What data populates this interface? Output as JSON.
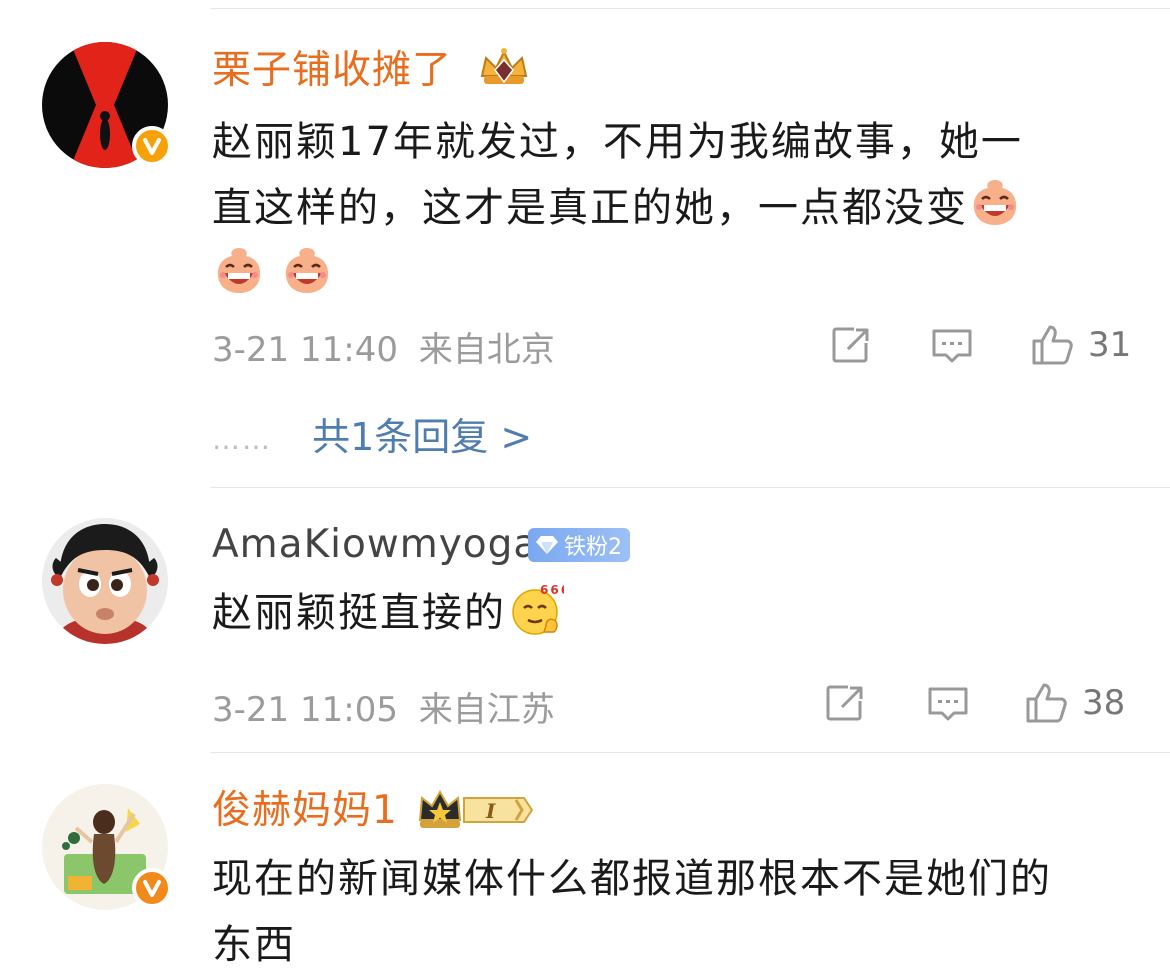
{
  "comments": [
    {
      "username": "栗子铺收摊了",
      "text_lines": [
        "赵丽颖17年就发过，不用为我编故事，她一",
        "直这样的，这才是真正的她，一点都没变"
      ],
      "time": "3-21 11:40",
      "location": "来自北京",
      "likes": "31",
      "reply_dots": "……",
      "reply_link": "共1条回复 >",
      "badge_icon": "crown-gem-badge-icon"
    },
    {
      "username": "AmaKiowmyoga",
      "fan_badge": "铁粉2",
      "text": "赵丽颖挺直接的",
      "time": "3-21 11:05",
      "location": "来自江苏",
      "likes": "38",
      "emoji_text": "666"
    },
    {
      "username": "俊赫妈妈1",
      "level_badge": "I",
      "text_lines": [
        "现在的新闻媒体什么都报道那根本不是她们的",
        "东西"
      ]
    }
  ],
  "colors": {
    "accent_orange": "#e96d1e",
    "link_blue": "#507daf",
    "meta_gray": "#9b9b9b",
    "verified_badge": "#f6a10a",
    "fan_badge": "#7aa8ef"
  }
}
